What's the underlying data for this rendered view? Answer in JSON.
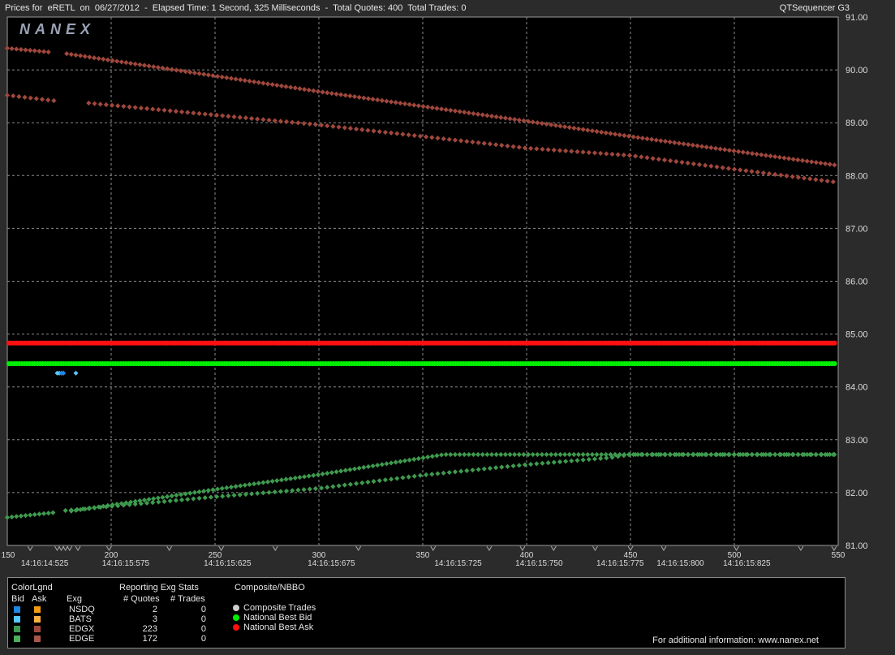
{
  "header": {
    "title": "Prices for  eRETL  on  06/27/2012  -  Elapsed Time: 1 Second, 325 Milliseconds  -  Total Quotes: 400  Total Trades: 0",
    "app_name": "QTSequencer G3"
  },
  "logo_text": "NANEX",
  "chart_data": {
    "type": "scatter",
    "xlim": [
      150,
      550
    ],
    "ylim": [
      81.0,
      91.0
    ],
    "y_ticks": [
      "81.00",
      "82.00",
      "83.00",
      "84.00",
      "85.00",
      "86.00",
      "87.00",
      "88.00",
      "89.00",
      "90.00",
      "91.00"
    ],
    "x_ticks": [
      "150",
      "200",
      "250",
      "300",
      "350",
      "400",
      "450",
      "500",
      "550"
    ],
    "time_labels": [
      {
        "x": 168,
        "label": "14:16:14:525"
      },
      {
        "x": 207,
        "label": "14:16:15:575"
      },
      {
        "x": 256,
        "label": "14:16:15:625"
      },
      {
        "x": 306,
        "label": "14:16:15:675"
      },
      {
        "x": 367,
        "label": "14:16:15:725"
      },
      {
        "x": 406,
        "label": "14:16:15:750"
      },
      {
        "x": 445,
        "label": "14:16:15:775"
      },
      {
        "x": 474,
        "label": "14:16:15:800"
      },
      {
        "x": 506,
        "label": "14:16:15:825"
      }
    ],
    "grid": true,
    "series": [
      {
        "name": "EDGX",
        "side": "ask",
        "color": "#a0473d",
        "x_start": 150,
        "x_end": 550,
        "gap_start": 171,
        "gap_end": 178,
        "step": 2.2,
        "knots": [
          [
            150,
            90.41
          ],
          [
            172,
            90.33
          ],
          [
            178,
            90.31
          ],
          [
            300,
            89.59
          ],
          [
            400,
            89.03
          ],
          [
            450,
            88.74
          ],
          [
            550,
            88.19
          ]
        ]
      },
      {
        "name": "EDGE",
        "side": "ask",
        "color": "#a0473d",
        "x_start": 150,
        "x_end": 550,
        "gap_start": 175,
        "gap_end": 187,
        "step": 2.8,
        "knots": [
          [
            150,
            89.52
          ],
          [
            174,
            89.41
          ],
          [
            187,
            89.38
          ],
          [
            300,
            88.96
          ],
          [
            400,
            88.52
          ],
          [
            450,
            88.38
          ],
          [
            500,
            88.12
          ],
          [
            550,
            87.87
          ]
        ]
      },
      {
        "name": "EDGX",
        "side": "bid",
        "color": "#3e9a4e",
        "x_start": 150,
        "x_end": 550,
        "gap_start": 173,
        "gap_end": 179,
        "step": 2.2,
        "knots": [
          [
            150,
            81.53
          ],
          [
            172,
            81.62
          ],
          [
            179,
            81.64
          ],
          [
            250,
            82.06
          ],
          [
            300,
            82.34
          ],
          [
            360,
            82.72
          ],
          [
            400,
            82.72
          ],
          [
            450,
            82.72
          ],
          [
            550,
            82.72
          ]
        ]
      },
      {
        "name": "EDGE",
        "side": "bid",
        "color": "#3e9a4e",
        "x_start": 178,
        "x_end": 550,
        "step": 2.8,
        "knots": [
          [
            178,
            81.66
          ],
          [
            250,
            81.92
          ],
          [
            300,
            82.08
          ],
          [
            350,
            82.33
          ],
          [
            400,
            82.53
          ],
          [
            440,
            82.66
          ],
          [
            450,
            82.72
          ],
          [
            550,
            82.72
          ]
        ]
      },
      {
        "name": "National Best Bid",
        "color": "#00ee00",
        "y": 84.44
      },
      {
        "name": "National Best Ask",
        "color": "#ff1010",
        "y": 84.83
      },
      {
        "name": "BATS",
        "side": "bid",
        "color": "#55c8ff",
        "points": [
          [
            174,
            84.26
          ],
          [
            175,
            84.26
          ],
          [
            176,
            84.26
          ],
          [
            177,
            84.26
          ],
          [
            183,
            84.26
          ]
        ]
      },
      {
        "name": "NSDQ",
        "side": "bid",
        "color": "#1e88e5",
        "points": [
          [
            176,
            84.26
          ],
          [
            177,
            84.26
          ]
        ]
      }
    ],
    "legend": {
      "color_legend_title": "ColorLgnd",
      "bid_label": "Bid",
      "ask_label": "Ask",
      "exg_label": "Exg",
      "stats_title": "Reporting Exg Stats",
      "quotes_label": "# Quotes",
      "trades_label": "# Trades",
      "rows": [
        {
          "exg": "NSDQ",
          "bid_color": "#1e88e5",
          "ask_color": "#f39c12",
          "quotes": "2",
          "trades": "0"
        },
        {
          "exg": "BATS",
          "bid_color": "#55c8ff",
          "ask_color": "#f5b041",
          "quotes": "3",
          "trades": "0"
        },
        {
          "exg": "EDGX",
          "bid_color": "#3e9a4e",
          "ask_color": "#a0473d",
          "quotes": "223",
          "trades": "0"
        },
        {
          "exg": "EDGE",
          "bid_color": "#4caf5a",
          "ask_color": "#a8554a",
          "quotes": "172",
          "trades": "0"
        }
      ],
      "composite_title": "Composite/NBBO",
      "composite_items": [
        {
          "label": "Composite Trades",
          "color": "#cfcfcf"
        },
        {
          "label": "National Best Bid",
          "color": "#00ee00"
        },
        {
          "label": "National Best Ask",
          "color": "#ff1010"
        }
      ]
    }
  },
  "footer_note": "For additional information: www.nanex.net"
}
